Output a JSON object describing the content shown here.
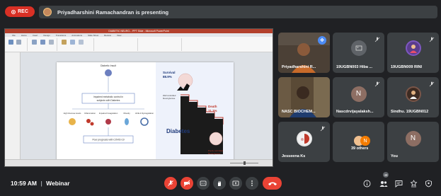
{
  "top_bar": {
    "rec_label": "REC",
    "presenting_text": "Priyadharshini Ramachandran is presenting"
  },
  "presentation": {
    "app_title": "DIABETIC NEURO... PPT Slide - Microsoft PowerPoint",
    "menu_items": [
      "File",
      "Home",
      "Insert",
      "Design",
      "Transitions",
      "Animations",
      "Slide Show",
      "Review",
      "View"
    ],
    "slide": {
      "top_node": "Diabetic Insult",
      "middle_box_line1": "Impaired metabolic control in",
      "middle_box_line2": "subjects with Diabetes",
      "branches": [
        "High Glucose levels",
        "Inflammation",
        "Impaired Coagulation",
        "Obesity",
        "ACE-2 Dysregulation"
      ],
      "bottom_box": "Poor prognosis with COVID-19",
      "survival_label": "Survival",
      "survival_value": "88.9%",
      "well_controlled_line1": "Well controlled",
      "well_controlled_line2": "blood glucose",
      "death_label": "Death",
      "death_value": "11.1%",
      "poorly_controlled_line1": "Poorly controlled",
      "poorly_controlled_line2": "blood glucose",
      "diabetes_label": "Diabetes"
    }
  },
  "participants": [
    {
      "name": "Priyadharshini R...",
      "type": "video",
      "pinned": true
    },
    {
      "name": "19UGBN003 Hiba ...",
      "type": "avatar",
      "avatar_letter": "",
      "avatar_color": "#5f6368"
    },
    {
      "name": "19UGBN009 RINI",
      "type": "avatar",
      "avatar_letter": "",
      "avatar_color": "#7e57c2"
    },
    {
      "name": "NASC BIOCHEM...",
      "type": "video"
    },
    {
      "name": "Nascdrvijayalaksh...",
      "type": "avatar",
      "avatar_letter": "N",
      "avatar_color": "#8d6e63"
    },
    {
      "name": "Sindhu. 19UGBN012",
      "type": "avatar",
      "avatar_letter": "",
      "avatar_color": "#795548"
    },
    {
      "name": "Jesseena Ks",
      "type": "avatar",
      "avatar_letter": "",
      "avatar_color": "#e6e6e6"
    },
    {
      "name": "39 others",
      "type": "others",
      "avatar_letter": "N",
      "avatar_color": "#f57c00"
    },
    {
      "name": "You",
      "type": "avatar",
      "avatar_letter": "N",
      "avatar_color": "#8d6e63"
    }
  ],
  "bottom_bar": {
    "time": "10:59 AM",
    "separator": "|",
    "meeting_name": "Webinar",
    "people_count": "48"
  },
  "colors": {
    "background": "#202124",
    "tile": "#3c4043",
    "danger": "#ea4335",
    "accent": "#4c8bf5"
  }
}
